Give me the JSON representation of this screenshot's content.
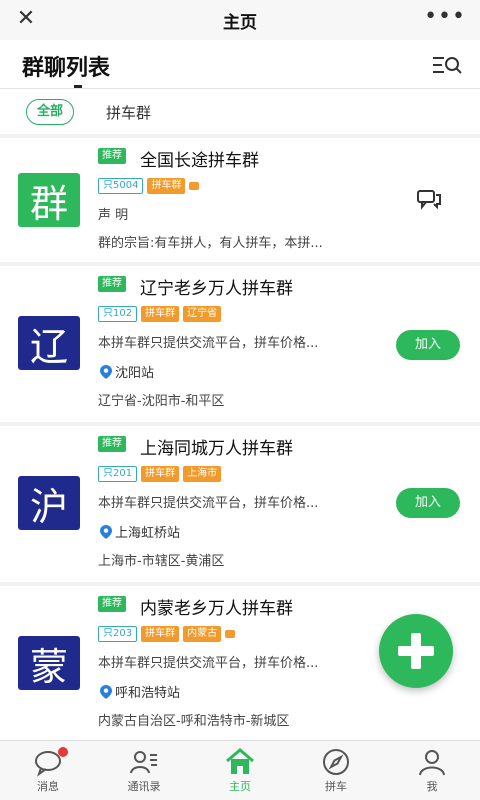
{
  "topbar": {
    "close_icon": "close-icon",
    "title": "主页",
    "more_icon": "more-icon"
  },
  "page": {
    "title": "群聊列表",
    "search_icon": "search-list-icon"
  },
  "filters": {
    "all": "全部",
    "carpool": "拼车群"
  },
  "groups": [
    {
      "avatar_char": "群",
      "avatar_color": "#2eb85c",
      "badge": "推荐",
      "name": "全国长途拼车群",
      "members": "只5004",
      "tags": [
        "拼车群"
      ],
      "line1": "声 明",
      "line2": "群的宗旨:有车拼人，有人拼车，本拼...",
      "action_icon": "chat-icon"
    },
    {
      "avatar_char": "辽",
      "avatar_color": "#1f2a8c",
      "badge": "推荐",
      "name": "辽宁老乡万人拼车群",
      "members": "只102",
      "tags": [
        "拼车群",
        "辽宁省"
      ],
      "desc": "本拼车群只提供交流平台，拼车价格...",
      "location": "沈阳站",
      "region": "辽宁省-沈阳市-和平区",
      "join": "加入"
    },
    {
      "avatar_char": "沪",
      "avatar_color": "#1f2a8c",
      "badge": "推荐",
      "name": "上海同城万人拼车群",
      "members": "只201",
      "tags": [
        "拼车群",
        "上海市"
      ],
      "desc": "本拼车群只提供交流平台，拼车价格...",
      "location": "上海虹桥站",
      "region": "上海市-市辖区-黄浦区",
      "join": "加入"
    },
    {
      "avatar_char": "蒙",
      "avatar_color": "#1f2a8c",
      "badge": "推荐",
      "name": "内蒙老乡万人拼车群",
      "members": "只203",
      "tags": [
        "拼车群",
        "内蒙古"
      ],
      "desc": "本拼车群只提供交流平台，拼车价格...",
      "location": "呼和浩特站",
      "region": "内蒙古自治区-呼和浩特市-新城区"
    }
  ],
  "tabs": [
    {
      "label": "消息",
      "icon": "message-icon"
    },
    {
      "label": "通讯录",
      "icon": "contacts-icon"
    },
    {
      "label": "主页",
      "icon": "home-icon"
    },
    {
      "label": "拼车",
      "icon": "compass-icon"
    },
    {
      "label": "我",
      "icon": "profile-icon"
    }
  ],
  "colors": {
    "accent": "#2eb85c",
    "tag_orange": "#f39a2d",
    "member_blue": "#35a7c7",
    "avatar_navy": "#1f2a8c",
    "notify_red": "#e53935"
  }
}
